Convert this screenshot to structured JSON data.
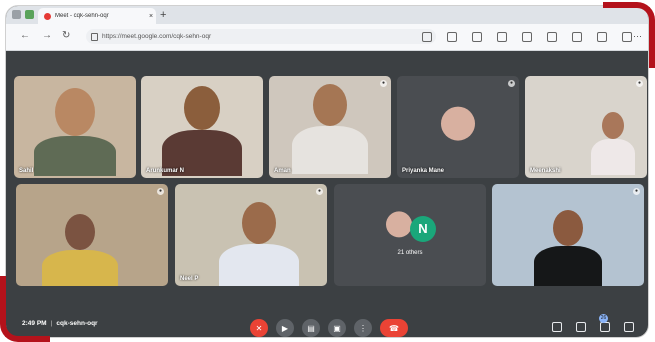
{
  "browser": {
    "tab_title": "Meet - cqk-sehn-oqr",
    "tab_close": "×",
    "new_tab": "+",
    "url": "https://meet.google.com/cqk-sehn-oqr",
    "nav": {
      "back": "←",
      "forward": "→",
      "reload": "↻"
    },
    "menu": "⋯"
  },
  "participants": [
    {
      "name": "Sahil",
      "bg": "#c8b6a0"
    },
    {
      "name": "Arunkumar N",
      "bg": "#d8d0c4"
    },
    {
      "name": "Aman",
      "bg": "#cfc7bd"
    },
    {
      "name": "Priyanka Mane",
      "bg": "#4a4d51"
    },
    {
      "name": "Meenakshi",
      "bg": "#d9d4cc"
    },
    {
      "name": "",
      "bg": "#b7a48a"
    },
    {
      "name": "Neel P",
      "bg": "#c9c2b2"
    },
    {
      "name": "21 others",
      "bg": "#4a4d51",
      "initial": "N"
    },
    {
      "name": "",
      "bg": "#b4c3d1"
    }
  ],
  "meeting": {
    "time": "2:49 PM",
    "code": "cqk-sehn-oqr",
    "people_count": "26"
  },
  "colors": {
    "end_call": "#ea4335",
    "control": "#5f6368",
    "background": "#3c4043",
    "accent_n": "#1aa77a"
  }
}
